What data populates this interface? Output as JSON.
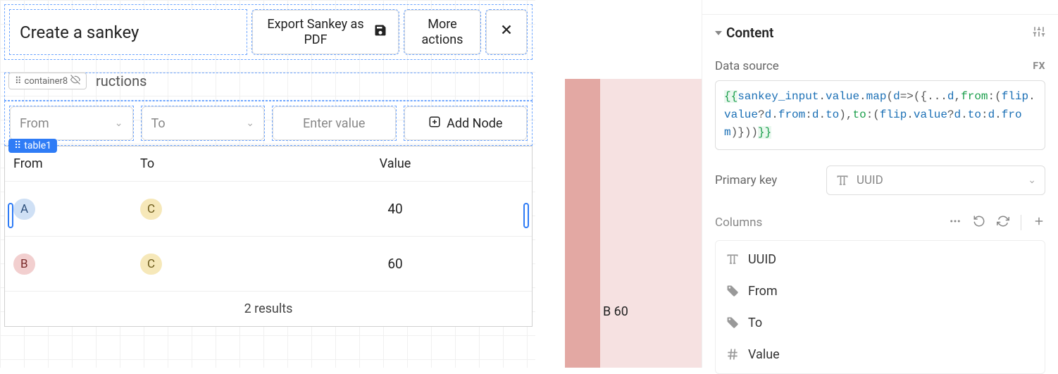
{
  "toolbar": {
    "title": "Create a sankey",
    "export_label": "Export Sankey as PDF",
    "more_label": "More actions"
  },
  "container8_label": "container8",
  "partial_text": "ructions",
  "inputs": {
    "from_placeholder": "From",
    "to_placeholder": "To",
    "value_placeholder": "Enter value",
    "add_node_label": "Add Node"
  },
  "table_badge": "table1",
  "table": {
    "headers": {
      "from": "From",
      "to": "To",
      "value": "Value"
    },
    "rows": [
      {
        "from": "A",
        "to": "C",
        "value": "40",
        "from_class": "chip-a",
        "to_class": "chip-c"
      },
      {
        "from": "B",
        "to": "C",
        "value": "60",
        "from_class": "chip-b",
        "to_class": "chip-c"
      }
    ],
    "footer": "2 results"
  },
  "preview": {
    "label": "B 60"
  },
  "inspector": {
    "section": "Content",
    "data_source_label": "Data source",
    "fx": "FX",
    "code_tokens": [
      {
        "c": "tok-br",
        "t": "{{"
      },
      {
        "c": "tok-id",
        "t": "sankey_input"
      },
      {
        "c": "tok-op",
        "t": "."
      },
      {
        "c": "tok-prop",
        "t": "value"
      },
      {
        "c": "tok-op",
        "t": "."
      },
      {
        "c": "tok-prop",
        "t": "map"
      },
      {
        "c": "tok-op",
        "t": "("
      },
      {
        "c": "tok-id",
        "t": "d"
      },
      {
        "c": "tok-op",
        "t": "=>({..."
      },
      {
        "c": "tok-id",
        "t": "d"
      },
      {
        "c": "tok-op",
        "t": ","
      },
      {
        "c": "tok-kw",
        "t": "from"
      },
      {
        "c": "tok-op",
        "t": ":("
      },
      {
        "c": "tok-id",
        "t": "flip"
      },
      {
        "c": "tok-op",
        "t": "."
      },
      {
        "c": "tok-prop",
        "t": "value"
      },
      {
        "c": "tok-op",
        "t": "?"
      },
      {
        "c": "tok-id",
        "t": "d"
      },
      {
        "c": "tok-op",
        "t": "."
      },
      {
        "c": "tok-prop",
        "t": "from"
      },
      {
        "c": "tok-op",
        "t": ":"
      },
      {
        "c": "tok-id",
        "t": "d"
      },
      {
        "c": "tok-op",
        "t": "."
      },
      {
        "c": "tok-prop",
        "t": "to"
      },
      {
        "c": "tok-op",
        "t": "),"
      },
      {
        "c": "tok-kw",
        "t": "to"
      },
      {
        "c": "tok-op",
        "t": ":("
      },
      {
        "c": "tok-id",
        "t": "flip"
      },
      {
        "c": "tok-op",
        "t": "."
      },
      {
        "c": "tok-prop",
        "t": "value"
      },
      {
        "c": "tok-op",
        "t": "?"
      },
      {
        "c": "tok-id",
        "t": "d"
      },
      {
        "c": "tok-op",
        "t": "."
      },
      {
        "c": "tok-prop",
        "t": "to"
      },
      {
        "c": "tok-op",
        "t": ":"
      },
      {
        "c": "tok-id",
        "t": "d"
      },
      {
        "c": "tok-op",
        "t": "."
      },
      {
        "c": "tok-prop",
        "t": "from"
      },
      {
        "c": "tok-op",
        "t": ")}))"
      },
      {
        "c": "tok-br",
        "t": "}}"
      }
    ],
    "primary_key_label": "Primary key",
    "primary_key_value": "UUID",
    "columns_label": "Columns",
    "columns": [
      {
        "name": "UUID",
        "icon": "text"
      },
      {
        "name": "From",
        "icon": "tag"
      },
      {
        "name": "To",
        "icon": "tag"
      },
      {
        "name": "Value",
        "icon": "hash"
      }
    ]
  }
}
